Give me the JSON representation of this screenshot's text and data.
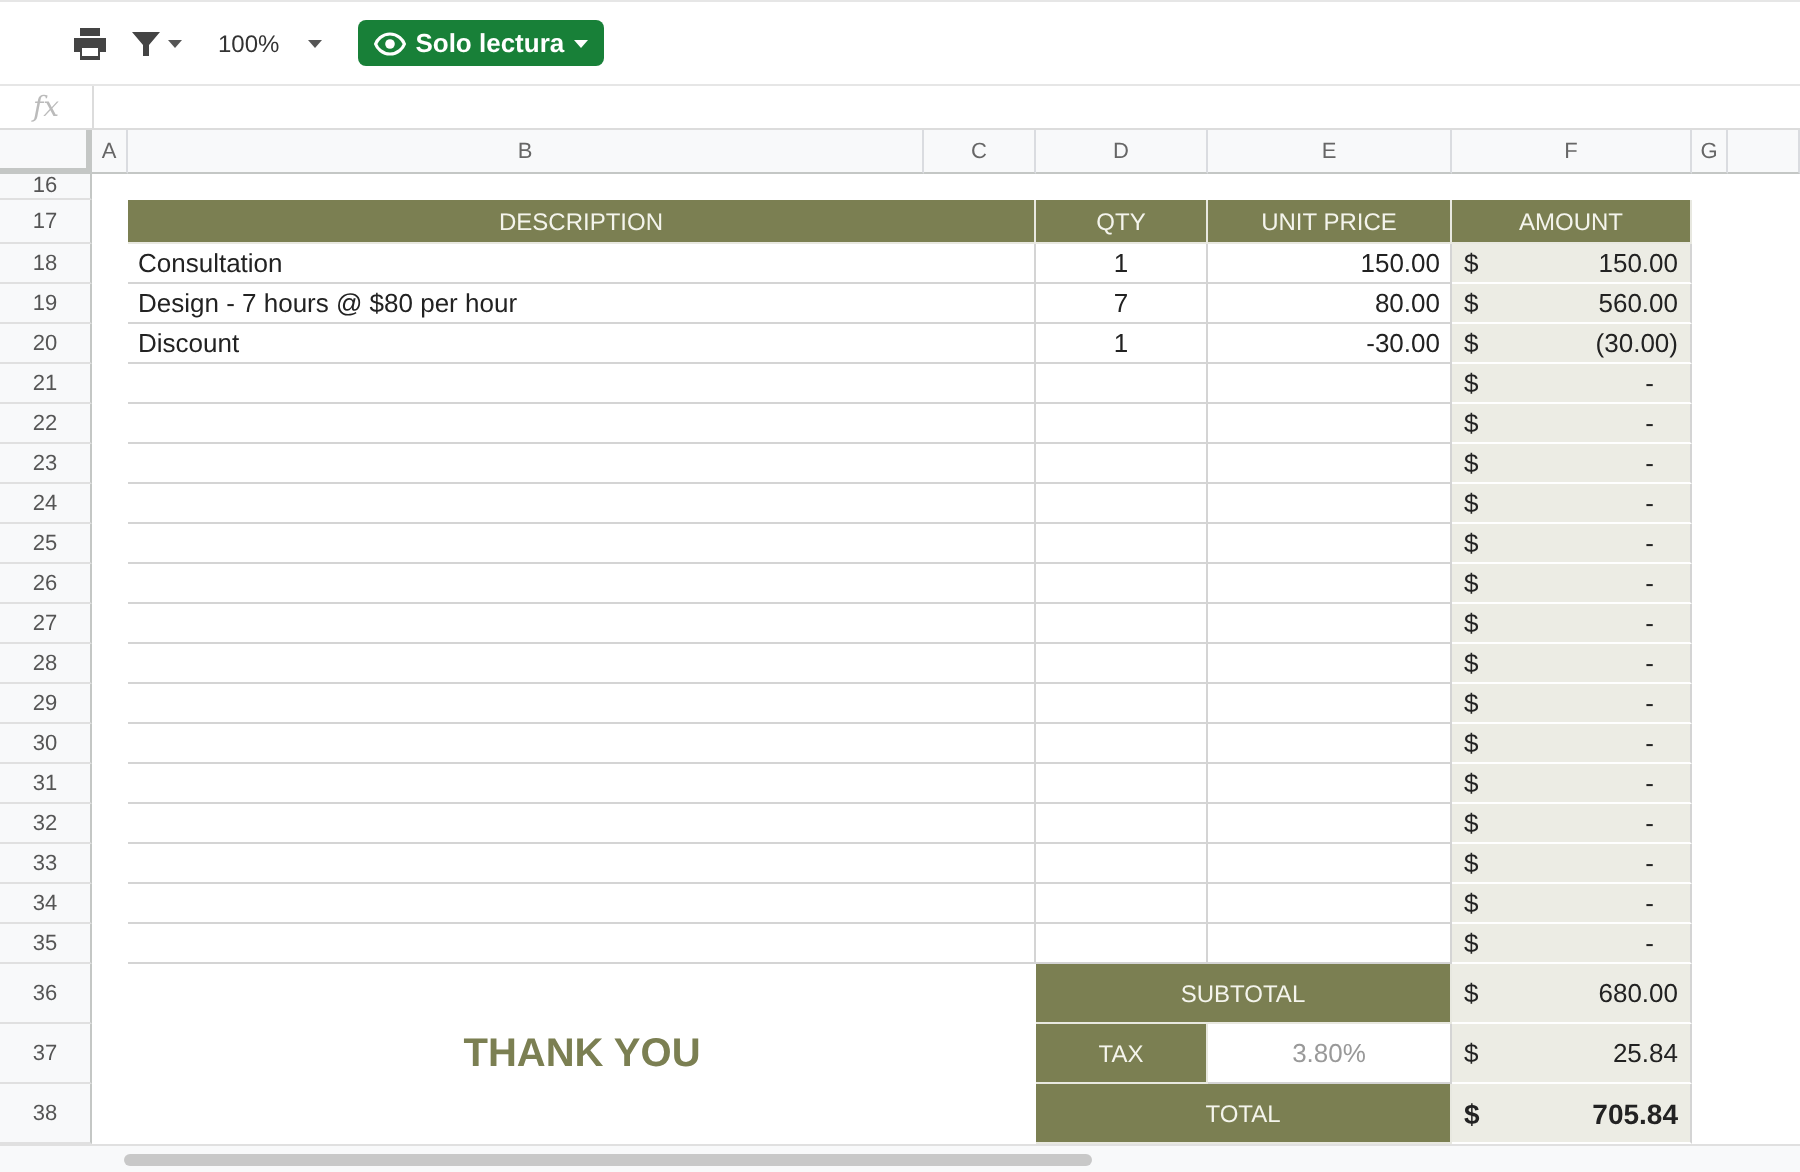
{
  "toolbar": {
    "zoom": "100%",
    "mode_button": "Solo lectura"
  },
  "formula_bar": {
    "fx_label": "fx"
  },
  "column_headers": [
    "A",
    "B",
    "C",
    "D",
    "E",
    "F",
    "G"
  ],
  "blank_row": "16",
  "header_row": {
    "row": "17",
    "columns": [
      "DESCRIPTION",
      "QTY",
      "UNIT PRICE",
      "AMOUNT"
    ]
  },
  "rows": [
    {
      "row": "18",
      "description": "Consultation",
      "qty": "1",
      "unit_price": "150.00",
      "currency": "$",
      "amount": "150.00"
    },
    {
      "row": "19",
      "description": "Design - 7 hours @ $80 per hour",
      "qty": "7",
      "unit_price": "80.00",
      "currency": "$",
      "amount": "560.00"
    },
    {
      "row": "20",
      "description": "Discount",
      "qty": "1",
      "unit_price": "-30.00",
      "currency": "$",
      "amount": "(30.00)"
    },
    {
      "row": "21",
      "currency": "$",
      "amount": "-"
    },
    {
      "row": "22",
      "currency": "$",
      "amount": "-"
    },
    {
      "row": "23",
      "currency": "$",
      "amount": "-"
    },
    {
      "row": "24",
      "currency": "$",
      "amount": "-"
    },
    {
      "row": "25",
      "currency": "$",
      "amount": "-"
    },
    {
      "row": "26",
      "currency": "$",
      "amount": "-"
    },
    {
      "row": "27",
      "currency": "$",
      "amount": "-"
    },
    {
      "row": "28",
      "currency": "$",
      "amount": "-"
    },
    {
      "row": "29",
      "currency": "$",
      "amount": "-"
    },
    {
      "row": "30",
      "currency": "$",
      "amount": "-"
    },
    {
      "row": "31",
      "currency": "$",
      "amount": "-"
    },
    {
      "row": "32",
      "currency": "$",
      "amount": "-"
    },
    {
      "row": "33",
      "currency": "$",
      "amount": "-"
    },
    {
      "row": "34",
      "currency": "$",
      "amount": "-"
    },
    {
      "row": "35",
      "currency": "$",
      "amount": "-"
    }
  ],
  "totals": [
    {
      "row": "36",
      "kind": "subtotal",
      "label": "SUBTOTAL",
      "currency": "$",
      "amount": "680.00"
    },
    {
      "row": "37",
      "kind": "tax",
      "label": "TAX",
      "rate": "3.80%",
      "currency": "$",
      "amount": "25.84",
      "note": "THANK YOU"
    },
    {
      "row": "38",
      "kind": "total",
      "label": "TOTAL",
      "currency": "$",
      "amount": "705.84"
    }
  ]
}
